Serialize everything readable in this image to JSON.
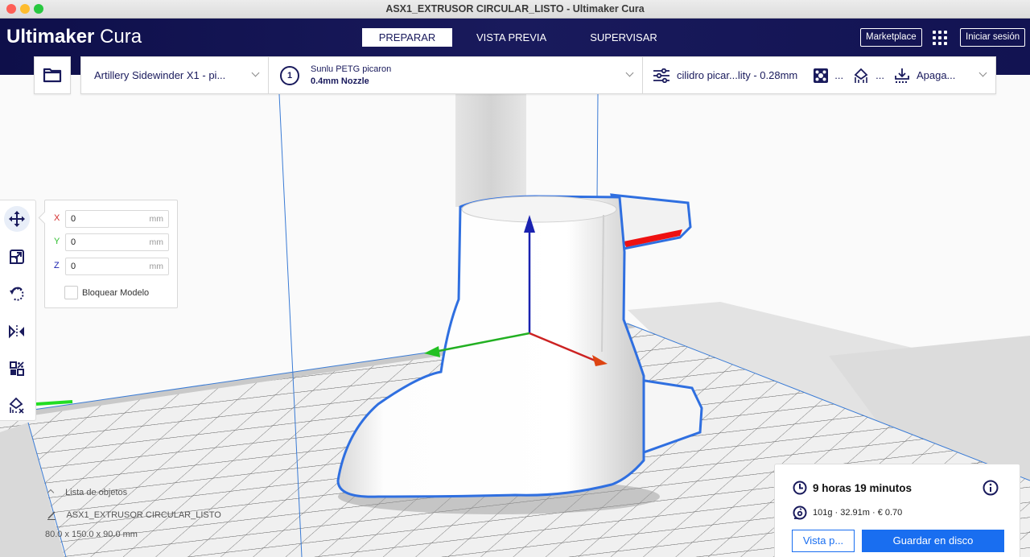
{
  "window": {
    "title": "ASX1_EXTRUSOR CIRCULAR_LISTO - Ultimaker Cura"
  },
  "header": {
    "logo_bold": "Ultimaker",
    "logo_light": "Cura",
    "tabs": [
      {
        "label": "PREPARAR",
        "active": true
      },
      {
        "label": "VISTA PREVIA",
        "active": false
      },
      {
        "label": "SUPERVISAR",
        "active": false
      }
    ],
    "marketplace_label": "Marketplace",
    "apps_icon": "grid-icon",
    "login_label": "Iniciar sesión"
  },
  "stage_bar": {
    "open_icon": "folder-icon",
    "printer": "Artillery Sidewinder X1 - pi...",
    "extruder_number": "1",
    "material": "Sunlu PETG picaron",
    "nozzle": "0.4mm Nozzle",
    "profile": "cilidro picar...lity - 0.28mm",
    "support_label": "...",
    "adhesion_label": "...",
    "adhesion_type": "Apaga..."
  },
  "tools": [
    {
      "name": "move",
      "icon": "move-icon",
      "active": true
    },
    {
      "name": "scale",
      "icon": "scale-icon",
      "active": false
    },
    {
      "name": "rotate",
      "icon": "rotate-icon",
      "active": false
    },
    {
      "name": "mirror",
      "icon": "mirror-icon",
      "active": false
    },
    {
      "name": "per-model-settings",
      "icon": "per-model-settings-icon",
      "active": false
    },
    {
      "name": "support-blocker",
      "icon": "support-blocker-icon",
      "active": false
    }
  ],
  "move_panel": {
    "x_label": "X",
    "x_value": "0",
    "y_label": "Y",
    "y_value": "0",
    "z_label": "Z",
    "z_value": "0",
    "unit": "mm",
    "lock_label": "Bloquear Modelo",
    "lock_checked": false
  },
  "object_list": {
    "title": "Lista de objetos",
    "object_name": "ASX1_EXTRUSOR CIRCULAR_LISTO",
    "dimensions": "80.0 x 150.0 x 90.0 mm"
  },
  "print_summary": {
    "time": "9 horas 19 minutos",
    "material_usage": "101g · 32.91m · € 0.70",
    "preview_label": "Vista p...",
    "save_label": "Guardar en disco"
  },
  "colors": {
    "header_bg": "#191a5c",
    "accent_blue": "#196ef0",
    "axis_x": "#d42b2b",
    "axis_y": "#2fbf2f",
    "axis_z": "#1a22b0"
  }
}
